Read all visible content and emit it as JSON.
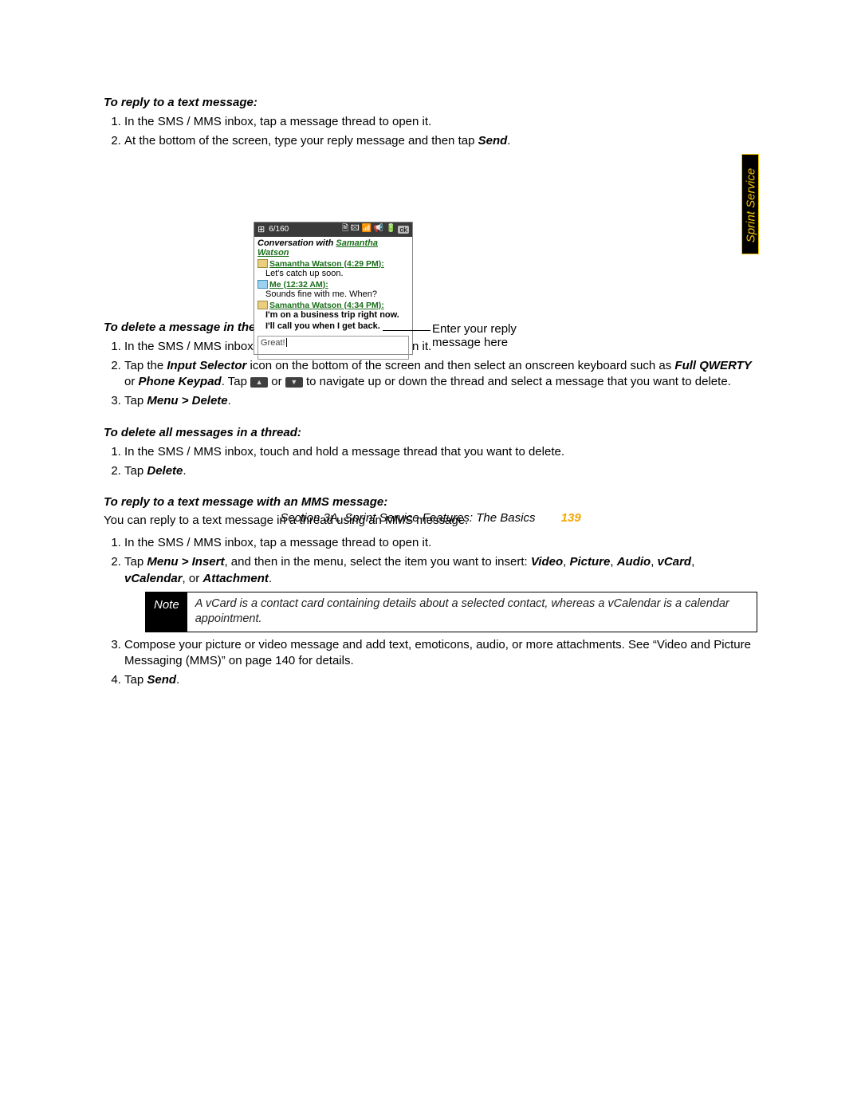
{
  "tab": "Sprint Service",
  "sec1": {
    "h": "To reply to a text message:",
    "s1": "In the SMS / MMS inbox, tap a message thread to open it.",
    "s2a": "At the bottom of the screen, type your reply message and then tap ",
    "s2b": "Send"
  },
  "phone": {
    "counter": "6/160",
    "ok": "ok",
    "title_pre": "Conversation with ",
    "title_name": "Samantha Watson",
    "m1s": "Samantha Watson (4:29 PM):",
    "m1t": "Let's catch up soon.",
    "m2s": "Me (12:32 AM):",
    "m2t": "Sounds fine with me. When?",
    "m3s": "Samantha Watson (4:34 PM):",
    "m3t1": "I'm on a business trip right now.",
    "m3t2": "I'll call you when I get back.",
    "reply": "Great!"
  },
  "callout": {
    "l1": "Enter your reply",
    "l2": "message here"
  },
  "sec2": {
    "h": "To delete a message in the thread:",
    "s1": "In the SMS / MMS inbox, tap a message thread to open it.",
    "s2a": "Tap the ",
    "s2b": "Input Selector",
    "s2c": " icon on the bottom of the screen and then select an onscreen keyboard such as ",
    "s2d": "Full QWERTY",
    "s2e": " or ",
    "s2f": "Phone Keypad",
    "s2g": ". Tap ",
    "up": "▲",
    "s2h": " or ",
    "dn": "▼",
    "s2i": " to navigate up or down the thread and select a message that you want to delete.",
    "s3a": "Tap ",
    "s3b": "Menu > Delete",
    "s3c": "."
  },
  "sec3": {
    "h": "To delete all messages in a thread:",
    "s1": "In the SMS / MMS inbox, touch and hold a message thread that you want to delete.",
    "s2a": "Tap ",
    "s2b": "Delete",
    "s2c": "."
  },
  "sec4": {
    "h": "To reply to a text message with an MMS message:",
    "intro": "You can reply to a text message in a thread using an MMS message.",
    "s1": "In the SMS / MMS inbox, tap a message thread to open it.",
    "s2a": "Tap ",
    "s2b": "Menu > Insert",
    "s2c": ", and then in the menu, select the item you want to insert: ",
    "i1": "Video",
    "c1": ", ",
    "i2": "Picture",
    "c2": ", ",
    "i3": "Audio",
    "c3": ", ",
    "i4": "vCard",
    "c4": ", ",
    "i5": "vCalendar",
    "c5": ", or ",
    "i6": "Attachment",
    "c6": ".",
    "note_l": "Note",
    "note_r": "A vCard is a contact card containing details about a selected contact, whereas a vCalendar is a calendar appointment.",
    "s3": "Compose your picture or video message and add text, emoticons, audio, or more attachments. See “Video and Picture Messaging (MMS)” on page 140 for details.",
    "s4a": "Tap ",
    "s4b": "Send",
    "s4c": "."
  },
  "footer": {
    "t": "Section 3A. Sprint Service Features: The Basics",
    "pg": "139"
  }
}
